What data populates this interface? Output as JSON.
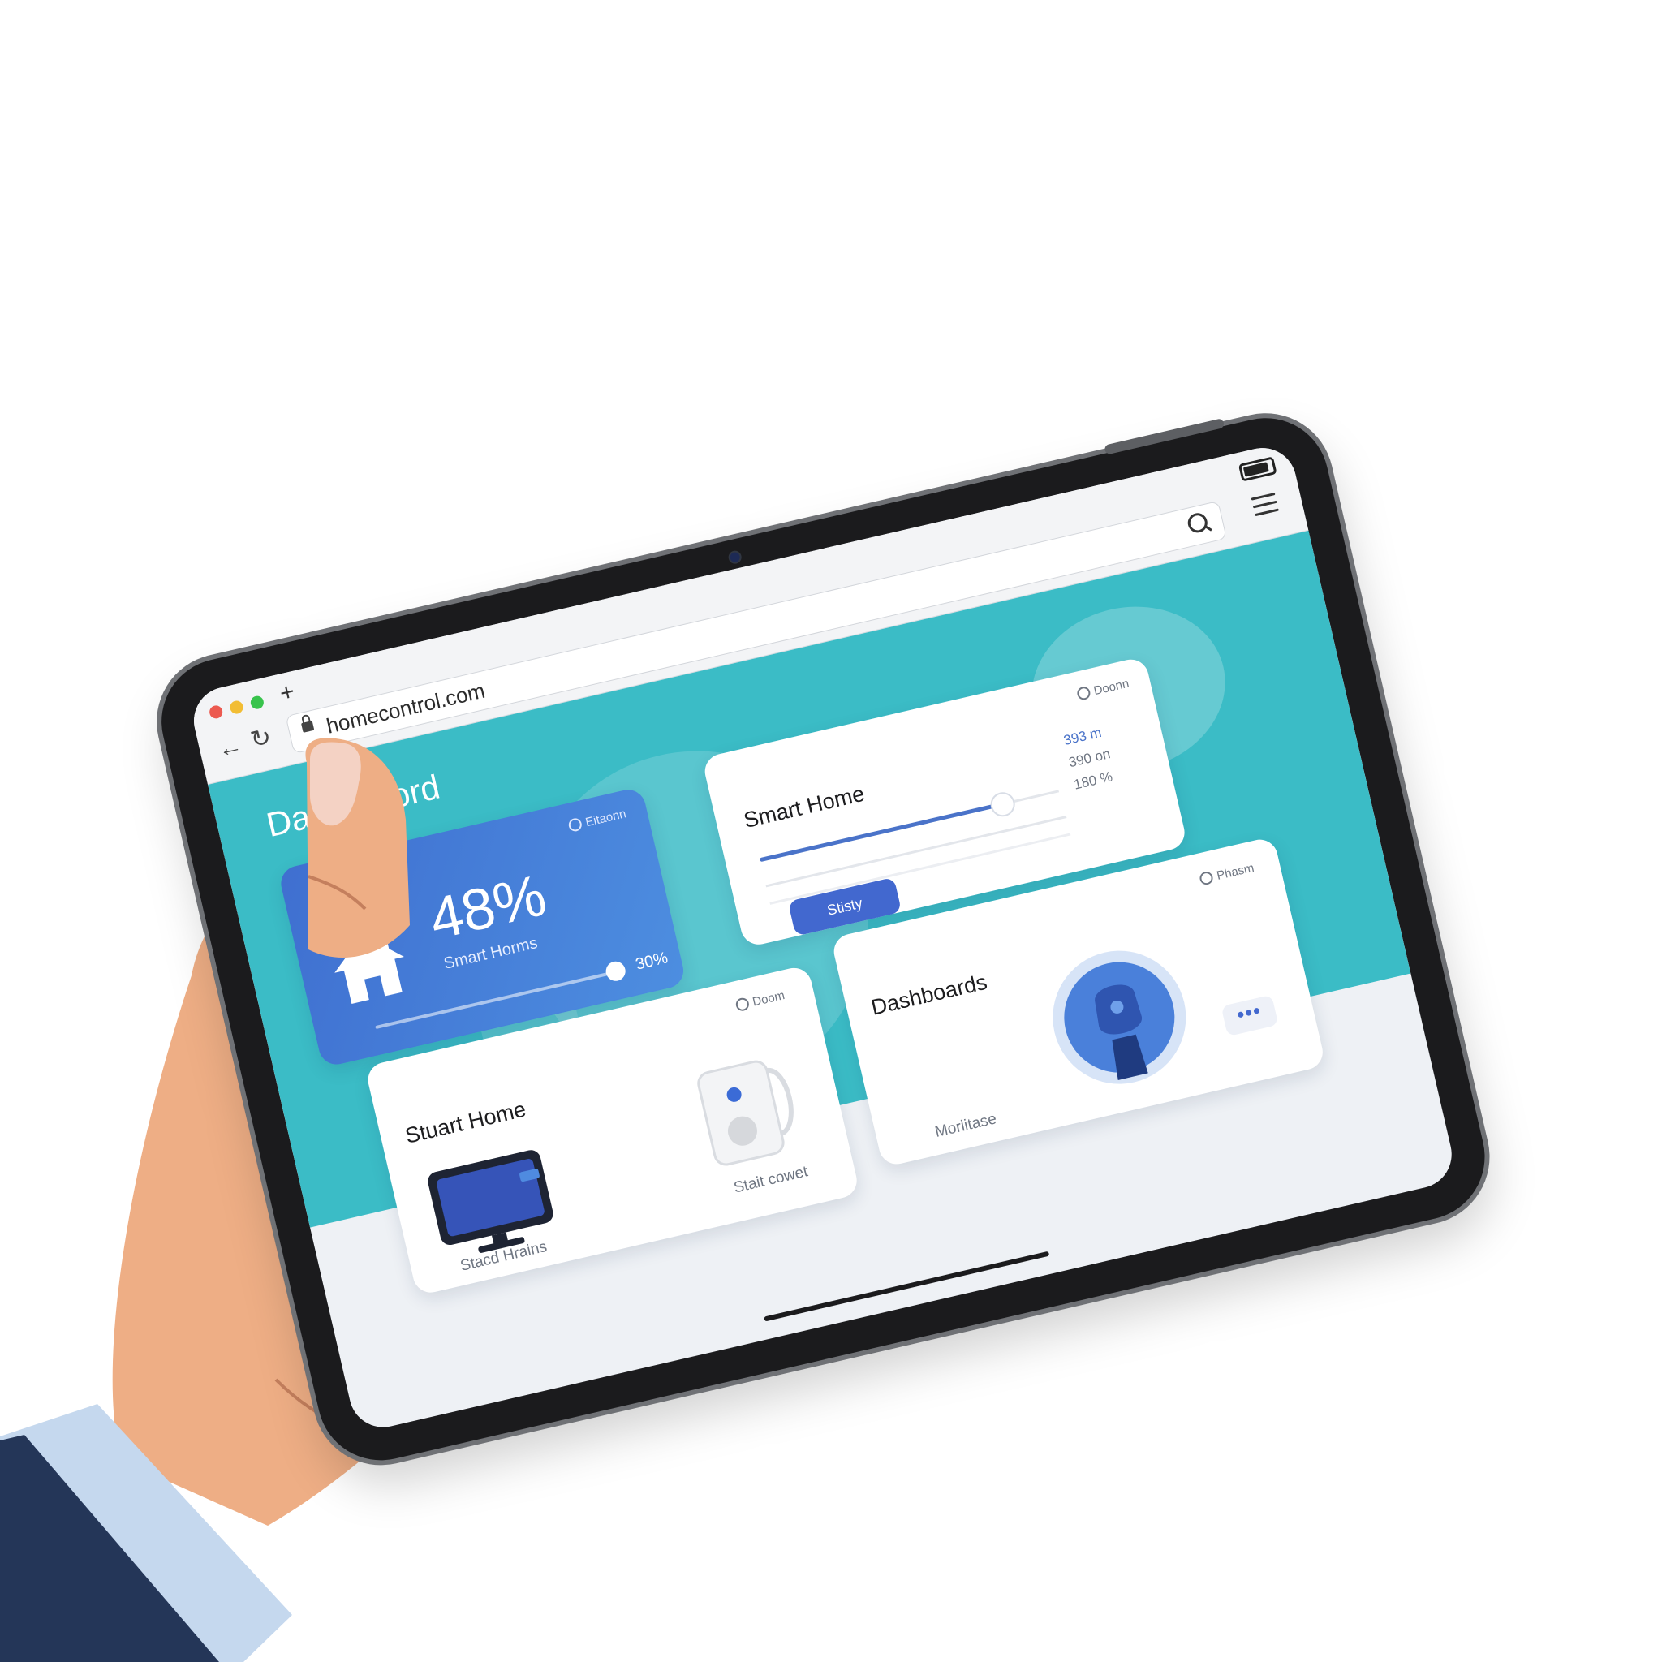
{
  "browser": {
    "new_tab_glyph": "+",
    "back_glyph": "←",
    "reload_glyph": "↻",
    "url": "homecontrol.com"
  },
  "page": {
    "title": "Dasthboord"
  },
  "main_card": {
    "tag": "Eitaonn",
    "value": "48%",
    "label": "Smart Horms",
    "slider_pct": "30%",
    "slider_level": 0.9
  },
  "top_right_card": {
    "tag": "Doonn",
    "title": "Smart Home",
    "stats": [
      "393 m",
      "390 on",
      "180 %"
    ],
    "slider_level": 0.8,
    "button_label": "Stisty"
  },
  "bottom_left_card": {
    "tag": "Doom",
    "title": "Stuart Home",
    "caption_left": "Stacd Hrains",
    "caption_right": "Stait cowet"
  },
  "bottom_right_card": {
    "tag": "Phasm",
    "title": "Dashboards",
    "more_label": "•••",
    "caption": "Moriitase"
  },
  "colors": {
    "hero": "#3bbcc6",
    "accent_blue": "#4268cf",
    "skin": "#eeae85",
    "sleeve": "#243658",
    "cuff": "#c5d8ee"
  }
}
